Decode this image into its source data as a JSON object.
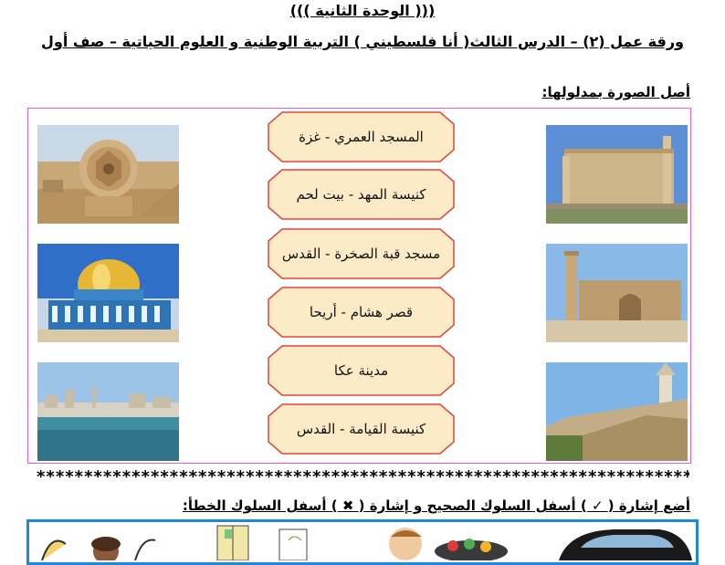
{
  "header": {
    "unit_title": "((( الوحدة الثانية )))",
    "worksheet_title": "ورقة عمل (٢) – الدرس الثالث( أنا فلسطيني ) التربية الوطنية و العلوم الحياتية – صف أول"
  },
  "matching": {
    "heading": "أصل الصورة بمدلولها:",
    "labels": [
      "المسجد العمري - غزة",
      "كنيسة المهد  - بيت لحم",
      "مسجد قبة الصخرة - القدس",
      "قصر هشام - أريحا",
      "مدينة عكا",
      "كنيسة القيامة - القدس"
    ]
  },
  "separator": "*****************************************************************************",
  "behaviour": {
    "heading_part1": "أضع إشارة (",
    "check_mark": "✓",
    "heading_part2": ") أسفل السلوك الصحيح  و إشارة (",
    "cross_mark": "✖",
    "heading_part3": ") أسفل السلوك الخطأ:"
  },
  "colors": {
    "frame_border": "#e25fd6",
    "label_fill": "#fdebc8",
    "label_border": "#e0463c",
    "bottom_frame": "#1f8ad1"
  }
}
